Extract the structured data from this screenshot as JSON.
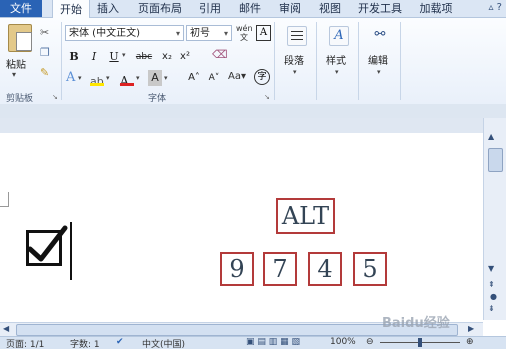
{
  "tabs": [
    "文件",
    "开始",
    "插入",
    "页面布局",
    "引用",
    "邮件",
    "审阅",
    "视图",
    "开发工具",
    "加载项"
  ],
  "clipboard": {
    "paste_label": "粘贴",
    "group_label": "剪贴板"
  },
  "font": {
    "family": "宋体 (中文正文)",
    "size": "初号",
    "group_label": "字体",
    "bold": "B",
    "italic": "I",
    "underline": "U",
    "strike": "abc",
    "sub": "x₂",
    "sup": "x²",
    "grow": "A˄",
    "shrink": "A˅",
    "phonetic": "wén",
    "char_border": "A",
    "enclose": "字"
  },
  "paragraph": {
    "label": "段落"
  },
  "styles": {
    "label": "样式"
  },
  "editing": {
    "label": "编辑"
  },
  "document": {
    "checkbox_glyph": "☑",
    "alt_text": "ALT",
    "digits": [
      "9",
      "7",
      "4",
      "5"
    ]
  },
  "status": {
    "page": "页面: 1/1",
    "words": "字数: 1",
    "language": "中文(中国)",
    "zoom": "100%"
  },
  "watermark": "Baidu经验"
}
